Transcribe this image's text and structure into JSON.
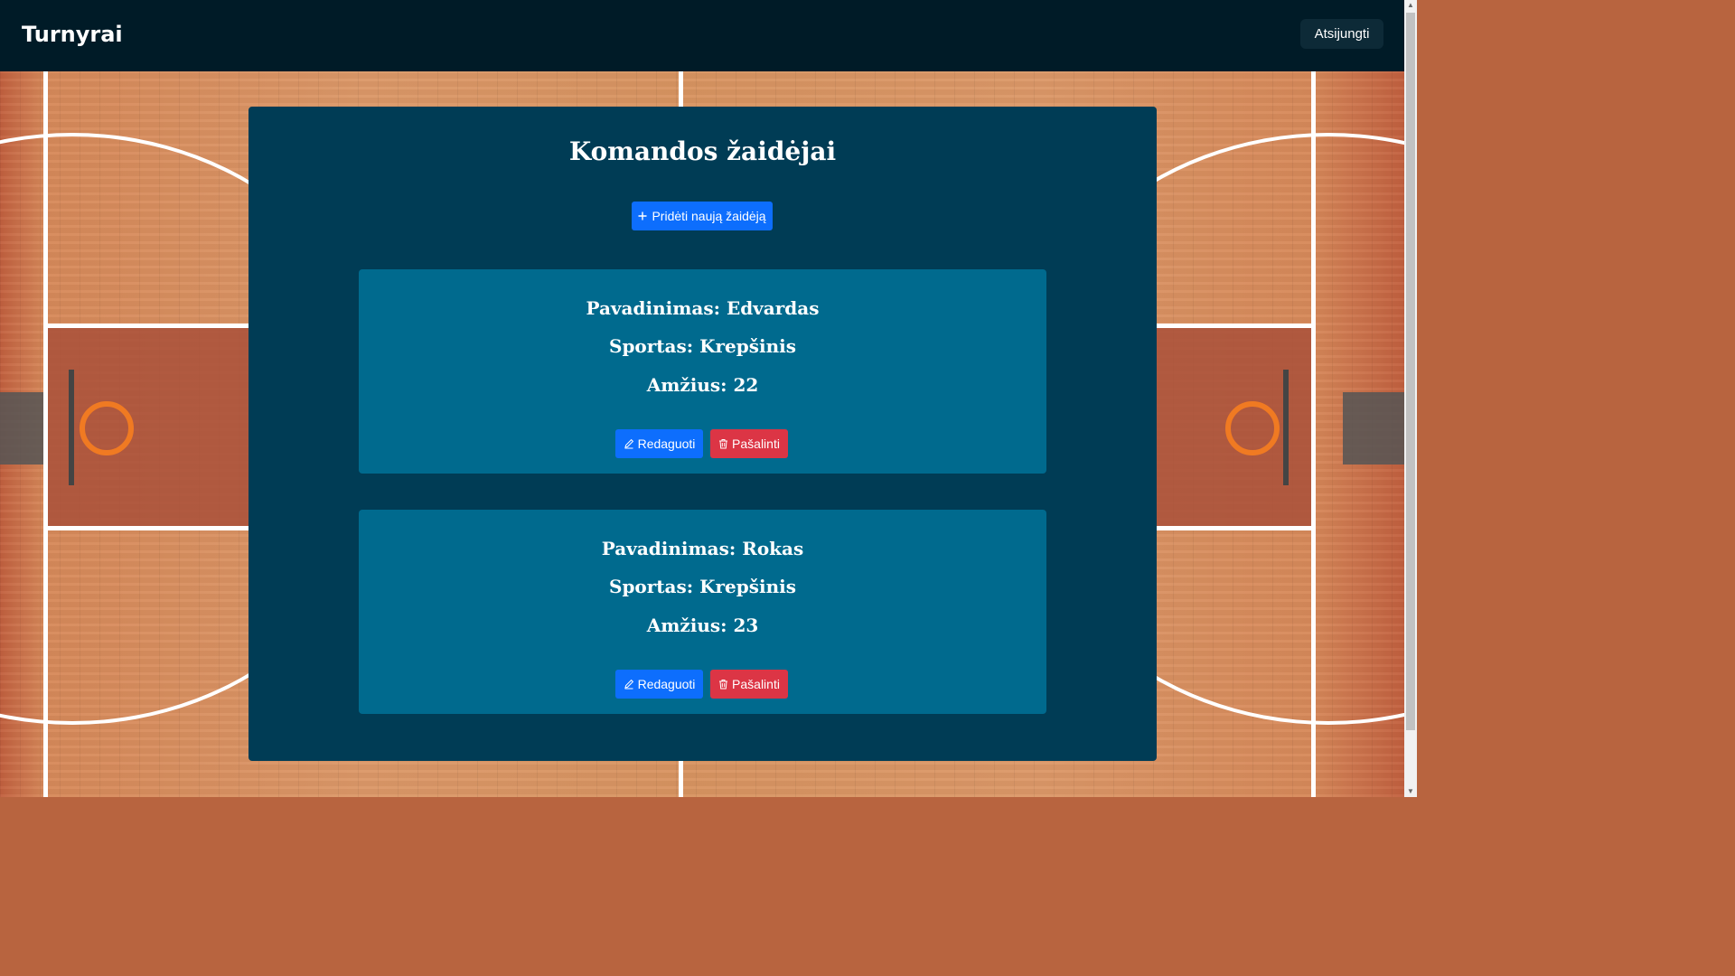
{
  "header": {
    "brand": "Turnyrai",
    "logout_label": "Atsijungti"
  },
  "main": {
    "title": "Komandos žaidėjai",
    "add_label": "Pridėti naują žaidėją",
    "add_icon": "plus-icon",
    "players": [
      {
        "name_line": "Pavadinimas: Edvardas",
        "sport_line": "Sportas: Krepšinis",
        "age_line": "Amžius: 22",
        "edit_label": "Redaguoti",
        "delete_label": "Pašalinti"
      },
      {
        "name_line": "Pavadinimas: Rokas",
        "sport_line": "Sportas: Krepšinis",
        "age_line": "Amžius: 23",
        "edit_label": "Redaguoti",
        "delete_label": "Pašalinti"
      }
    ]
  },
  "colors": {
    "header_bg": "#001b27",
    "panel_bg": "#003c55",
    "card_bg": "#006a8e",
    "primary": "#0d6efd",
    "danger": "#dc3545"
  },
  "icons": {
    "edit": "pencil-icon",
    "delete": "trash-icon"
  }
}
